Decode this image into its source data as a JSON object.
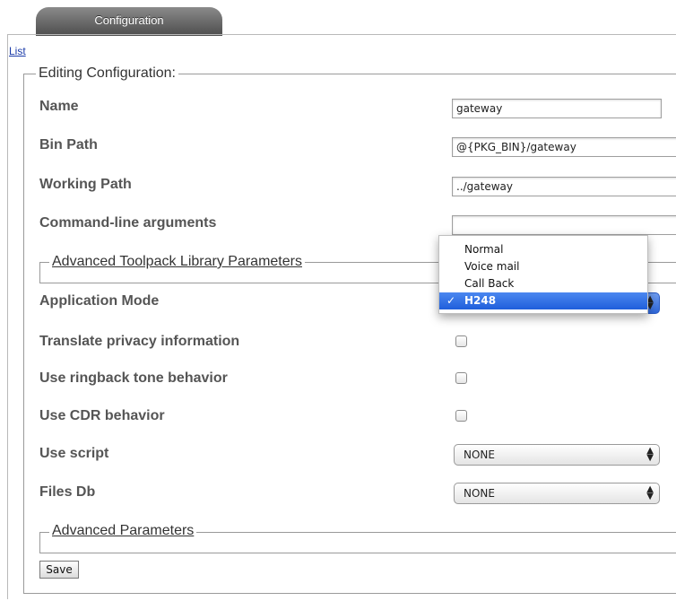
{
  "tab": {
    "label": "Configuration"
  },
  "nav": {
    "list_link": "List"
  },
  "editing": {
    "legend": "Editing Configuration:",
    "fields": {
      "name": {
        "label": "Name",
        "value": "gateway"
      },
      "bin_path": {
        "label": "Bin Path",
        "value": "@{PKG_BIN}/gateway"
      },
      "working_path": {
        "label": "Working Path",
        "value": "../gateway"
      },
      "cmd_args": {
        "label": "Command-line arguments",
        "value": ""
      }
    }
  },
  "advanced_toolpack": {
    "legend": "Advanced Toolpack Library Parameters",
    "application_mode": {
      "label": "Application Mode",
      "selected": "H248",
      "options": [
        "Normal",
        "Voice mail",
        "Call Back",
        "H248"
      ],
      "check_mark": "✓"
    },
    "translate_privacy": {
      "label": "Translate privacy information",
      "checked": false
    },
    "ringback_tone": {
      "label": "Use ringback tone behavior",
      "checked": false
    },
    "cdr_behavior": {
      "label": "Use CDR behavior",
      "checked": false
    },
    "use_script": {
      "label": "Use script",
      "value": "NONE"
    },
    "files_db": {
      "label": "Files Db",
      "value": "NONE"
    }
  },
  "advanced_params": {
    "legend": "Advanced Parameters"
  },
  "actions": {
    "save_label": "Save"
  },
  "icons": {
    "select_arrows": "⇕"
  }
}
